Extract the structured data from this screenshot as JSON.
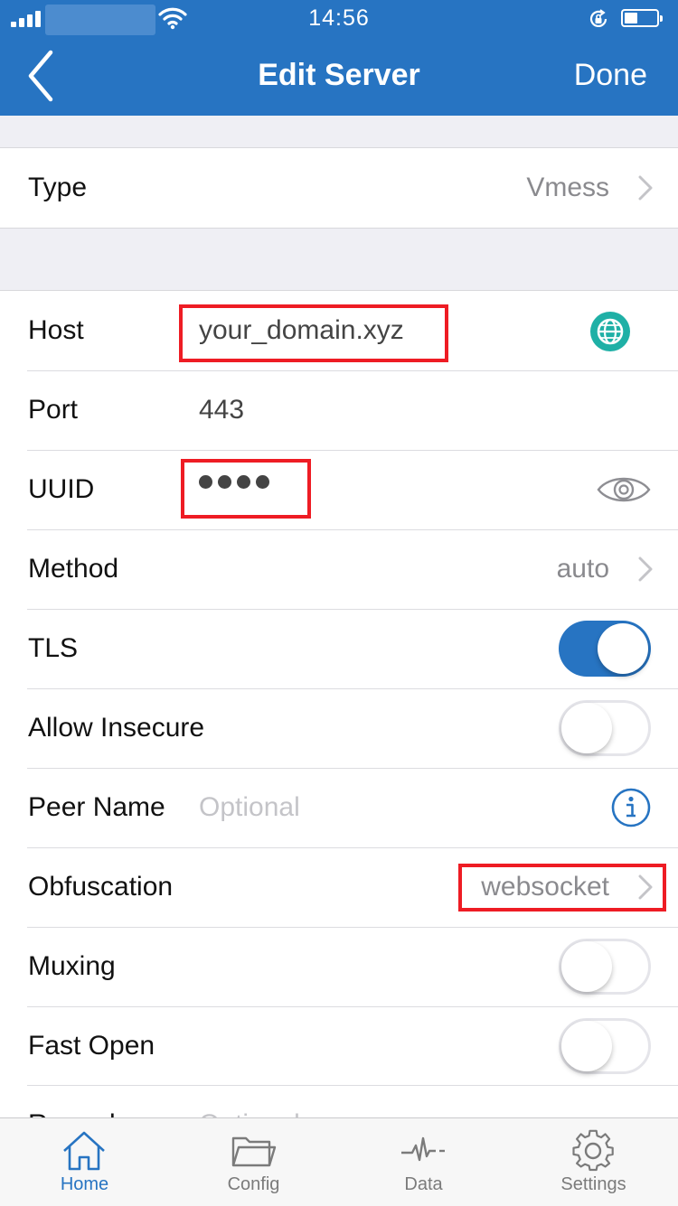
{
  "status_bar": {
    "time": "14:56"
  },
  "nav": {
    "title": "Edit Server",
    "done_label": "Done",
    "back_icon": "chevron-left-icon"
  },
  "type_section": {
    "label": "Type",
    "value": "Vmess"
  },
  "server": {
    "host": {
      "label": "Host",
      "value": "your_domain.xyz",
      "icon": "globe-icon"
    },
    "port": {
      "label": "Port",
      "value": "443"
    },
    "uuid": {
      "label": "UUID",
      "masked_value": "●●●●",
      "icon": "eye-icon"
    },
    "method": {
      "label": "Method",
      "value": "auto"
    },
    "tls": {
      "label": "TLS",
      "enabled": true
    },
    "allow_insecure": {
      "label": "Allow Insecure",
      "enabled": false
    },
    "peer_name": {
      "label": "Peer Name",
      "placeholder": "Optional",
      "icon": "info-icon"
    },
    "obfuscation": {
      "label": "Obfuscation",
      "value": "websocket"
    },
    "muxing": {
      "label": "Muxing",
      "enabled": false
    },
    "fast_open": {
      "label": "Fast Open",
      "enabled": false
    },
    "partial": {
      "label": "Remark",
      "placeholder": "Optional"
    }
  },
  "tabs": [
    {
      "label": "Home",
      "icon": "home-icon",
      "active": true
    },
    {
      "label": "Config",
      "icon": "folder-icon",
      "active": false
    },
    {
      "label": "Data",
      "icon": "pulse-icon",
      "active": false
    },
    {
      "label": "Settings",
      "icon": "gear-icon",
      "active": false
    }
  ],
  "colors": {
    "accent": "#2774c2",
    "highlight": "#ee1c24",
    "globe": "#1fb0a6"
  }
}
